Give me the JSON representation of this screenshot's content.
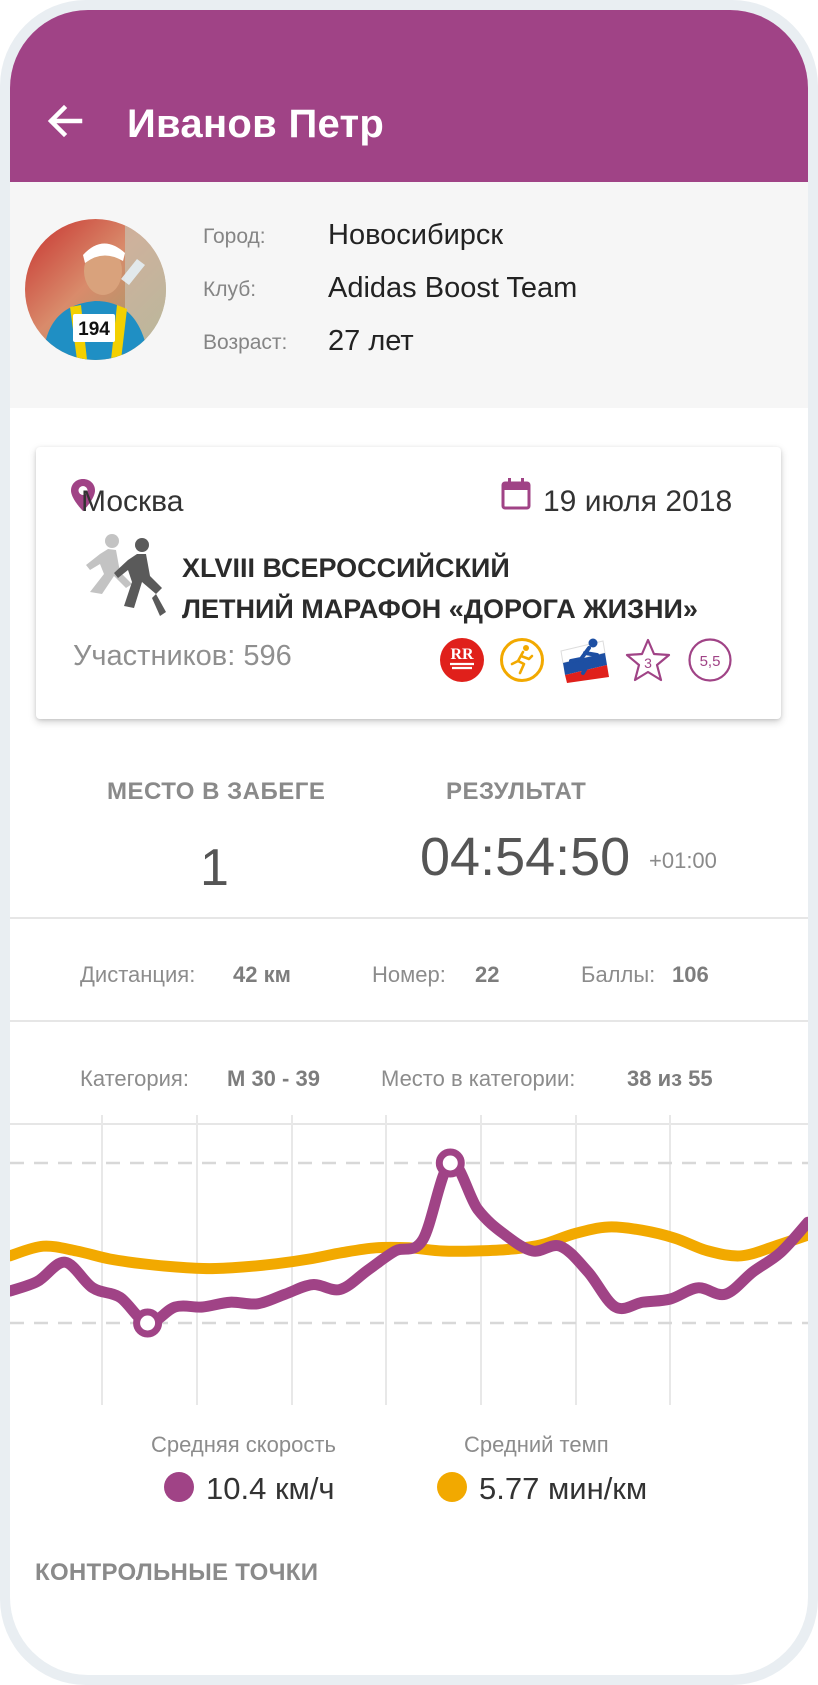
{
  "header": {
    "title": "Иванов Петр"
  },
  "profile": {
    "city_label": "Город:",
    "city": "Новосибирск",
    "club_label": "Клуб:",
    "club": "Adidas Boost Team",
    "age_label": "Возраст:",
    "age": "27 лет",
    "avatar_bib": "194"
  },
  "event": {
    "city": "Москва",
    "date": "19 июля 2018",
    "title_line1": "XLVIII ВСЕРОССИЙСКИЙ",
    "title_line2": "ЛЕТНИЙ МАРАФОН «ДОРОГА ЖИЗНИ»",
    "participants": "Участников: 596",
    "badges": [
      {
        "icon": "rr-logo-icon",
        "text": "RR",
        "color": "#e0201b"
      },
      {
        "icon": "runner-circle-icon",
        "color": "#f2a900"
      },
      {
        "icon": "russia-runner-icon",
        "color": "#1d4fa3"
      },
      {
        "icon": "star-icon",
        "text": "3",
        "color": "#a04386"
      },
      {
        "icon": "rating-circle-icon",
        "text": "5,5",
        "color": "#a04386"
      }
    ]
  },
  "results": {
    "place_label": "МЕСТО В ЗАБЕГЕ",
    "place": "1",
    "result_label": "РЕЗУЛЬТАТ",
    "result": "04:54:50",
    "delta": "+01:00"
  },
  "details": {
    "distance_label": "Дистанция:",
    "distance": "42 км",
    "number_label": "Номер:",
    "number": "22",
    "points_label": "Баллы:",
    "points": "106",
    "category_label": "Категория:",
    "category": "М 30 - 39",
    "category_place_label": "Место в категории:",
    "category_place": "38 из 55"
  },
  "chart_data": {
    "type": "line",
    "series": [
      {
        "name": "Средняя скорость",
        "color": "#a04386",
        "values": [
          0.2,
          0.26,
          0.38,
          0.22,
          0.16,
          0.0,
          0.1,
          0.1,
          0.13,
          0.12,
          0.18,
          0.24,
          0.21,
          0.33,
          0.45,
          0.52,
          1.0,
          0.71,
          0.55,
          0.45,
          0.48,
          0.32,
          0.1,
          0.13,
          0.15,
          0.22,
          0.18,
          0.32,
          0.44,
          0.63
        ]
      },
      {
        "name": "Средний темп",
        "color": "#f2a900",
        "values": [
          0.42,
          0.48,
          0.45,
          0.4,
          0.37,
          0.35,
          0.34,
          0.35,
          0.37,
          0.4,
          0.44,
          0.47,
          0.47,
          0.45,
          0.45,
          0.46,
          0.49,
          0.56,
          0.6,
          0.58,
          0.53,
          0.45,
          0.42,
          0.48,
          0.55
        ]
      }
    ],
    "markers": [
      {
        "series": 0,
        "index": 5
      },
      {
        "series": 0,
        "index": 16
      }
    ],
    "grid": true
  },
  "legend": {
    "speed_label": "Средняя скорость",
    "speed_value": "10.4 км/ч",
    "speed_color": "#a04386",
    "pace_label": "Средний темп",
    "pace_value": "5.77 мин/км",
    "pace_color": "#f2a900"
  },
  "checkpoints": {
    "title": "КОНТРОЛЬНЫЕ ТОЧКИ"
  }
}
